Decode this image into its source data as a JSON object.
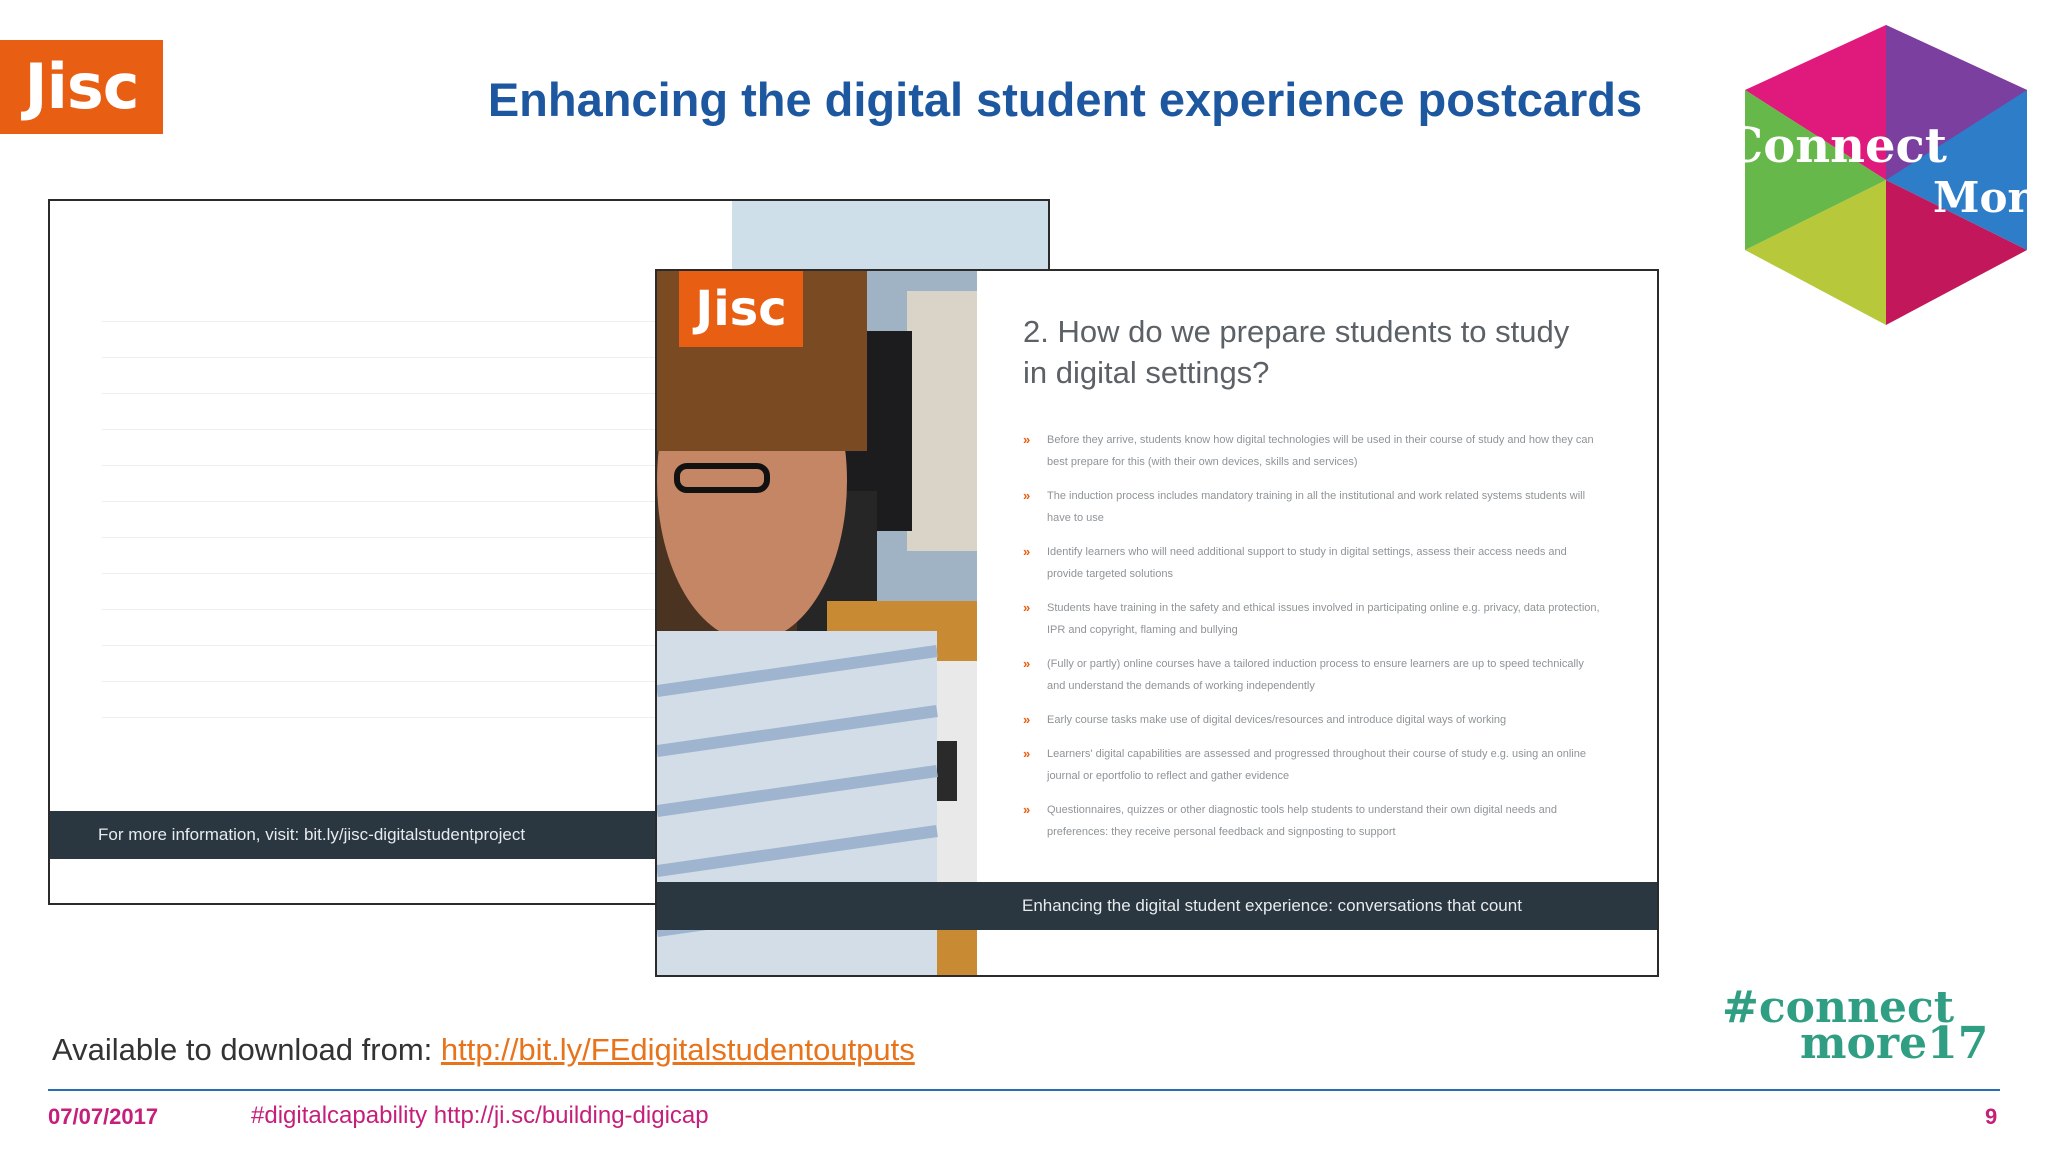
{
  "header": {
    "logo_text": "Jisc",
    "title": "Enhancing the digital student experience postcards",
    "event_logo": {
      "line1": "Connect",
      "line2": "More"
    }
  },
  "back_card": {
    "info_text": "For more information, visit: bit.ly/jisc-digitalstudentproject"
  },
  "front_card": {
    "logo_text": "Jisc",
    "heading_line1": "2. How do we prepare students to study",
    "heading_line2": "in digital settings?",
    "bullets": [
      "Before they arrive, students know how digital technologies will be used in their course of study and how they can best prepare for this (with their own devices, skills and services)",
      "The induction process includes mandatory training in all the institutional and work related systems students will have to use",
      "Identify learners who will need additional support to study in digital settings, assess their access needs and provide targeted solutions",
      "Students have training in the safety and ethical issues involved in participating online e.g. privacy, data protection, IPR and copyright, flaming and bullying",
      "(Fully or partly) online courses have a tailored induction process to ensure learners are up to speed technically and understand the demands of working independently",
      "Early course tasks make use of digital devices/resources and introduce digital ways of working",
      "Learners' digital capabilities are assessed and progressed throughout their course of study e.g. using an online journal or eportfolio to reflect and gather evidence",
      "Questionnaires, quizzes or other diagnostic tools help students to understand their own digital needs and preferences: they receive personal feedback and signposting to support"
    ],
    "bar_text": "Enhancing the digital student experience: conversations that count"
  },
  "download": {
    "label": "Available to download from: ",
    "url": "http://bit.ly/FEdigitalstudentoutputs"
  },
  "hashtag_logo": {
    "line1": "#connect",
    "line2": "more17"
  },
  "footer": {
    "date": "07/07/2017",
    "tags": "#digitalcapability http://ji.sc/building-digicap",
    "page": "9"
  },
  "colors": {
    "jisc_orange": "#e85e13",
    "title_blue": "#1c57a0",
    "footer_magenta": "#c51f7a",
    "dark_bar": "#2a3640",
    "link_orange": "#e8731a",
    "hashtag_teal": "#2f9e82"
  }
}
